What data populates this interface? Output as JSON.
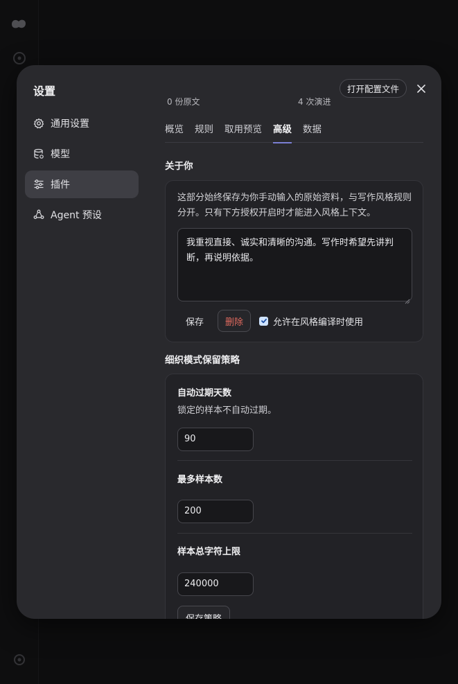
{
  "modal": {
    "title": "设置",
    "open_config_label": "打开配置文件"
  },
  "nav": {
    "items": [
      {
        "label": "通用设置",
        "icon": "gear-icon"
      },
      {
        "label": "模型",
        "icon": "database-icon"
      },
      {
        "label": "插件",
        "icon": "sliders-icon"
      },
      {
        "label": "Agent 预设",
        "icon": "agent-icon"
      }
    ],
    "active_index": 2
  },
  "summary": {
    "left": "0 份原文",
    "right": "4 次演进"
  },
  "tabs": [
    "概览",
    "规则",
    "取用预览",
    "高级",
    "数据"
  ],
  "active_tab": "高级",
  "about": {
    "title": "关于你",
    "description": "这部分始终保存为你手动输入的原始资料，与写作风格规则分开。只有下方授权开启时才能进入风格上下文。",
    "text": "我重视直接、诚实和清晰的沟通。写作时希望先讲判断，再说明依据。",
    "save_label": "保存",
    "delete_label": "删除",
    "allow_label": "允许在风格编译时使用",
    "allow_checked": true
  },
  "retention": {
    "title": "细织模式保留策略",
    "expire_label": "自动过期天数",
    "expire_help": "锁定的样本不自动过期。",
    "expire_value": "90",
    "max_samples_label": "最多样本数",
    "max_samples_value": "200",
    "char_limit_label": "样本总字符上限",
    "char_limit_value": "240000",
    "save_policy_label": "保存策略"
  },
  "colors": {
    "accent": "#7b7fd4",
    "danger": "#e06a5f",
    "modal_bg": "#29292d"
  }
}
